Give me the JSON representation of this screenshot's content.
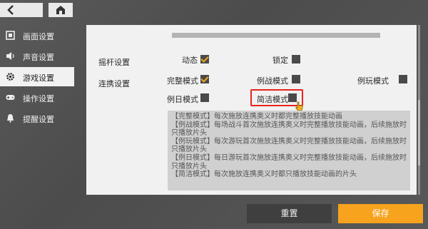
{
  "top_right_text": "",
  "sidebar": {
    "items": [
      {
        "label": "画面设置",
        "icon": "display-icon"
      },
      {
        "label": "声音设置",
        "icon": "speaker-icon"
      },
      {
        "label": "游戏设置",
        "icon": "gear-icon"
      },
      {
        "label": "操作设置",
        "icon": "gamepad-icon"
      },
      {
        "label": "提醒设置",
        "icon": "bell-icon"
      }
    ],
    "active_index": 2
  },
  "settings": {
    "joystick": {
      "label": "摇杆设置",
      "options": [
        {
          "label": "动态",
          "checked": true
        },
        {
          "label": "锁定",
          "checked": false
        }
      ]
    },
    "combo": {
      "label": "连携设置",
      "options": [
        {
          "label": "完整模式",
          "checked": true
        },
        {
          "label": "例战模式",
          "checked": false
        },
        {
          "label": "例玩模式",
          "checked": false
        },
        {
          "label": "例日模式",
          "checked": false
        },
        {
          "label": "简洁模式",
          "checked": false
        }
      ]
    }
  },
  "description": [
    "【完整模式】每次施放连携奥义时都完整播放技能动画",
    "【例战模式】每场战斗首次施放连携奥义时完整播放技能动画，后续施放时只播放片头",
    "【例玩模式】每次游玩首次施放连携奥义时完整播放技能动画，后续施放时只播放片头",
    "【例日模式】每日游玩首次施放连携奥义时完整播放技能动画，后续施放时只播放片头",
    "【简洁模式】每次施放连携奥义时都只播放技能动画的片头"
  ],
  "buttons": {
    "reset": "重置",
    "save": "保存"
  },
  "colors": {
    "accent": "#f7a31e",
    "highlight_box": "#e8231d"
  }
}
